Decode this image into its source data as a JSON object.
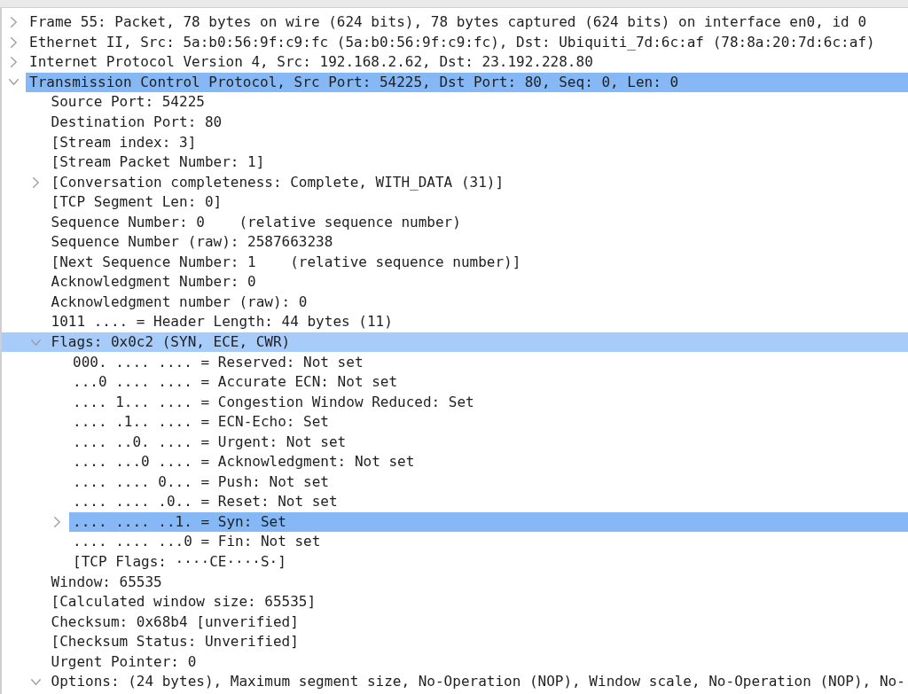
{
  "tree": [
    {
      "kind": "group",
      "label": "Frame 55: Packet, 78 bytes on wire (624 bits), 78 bytes captured (624 bits) on interface en0, id 0",
      "expanded": false,
      "selected": false,
      "highlighted": false
    },
    {
      "kind": "group",
      "label": "Ethernet II, Src: 5a:b0:56:9f:c9:fc (5a:b0:56:9f:c9:fc), Dst: Ubiquiti_7d:6c:af (78:8a:20:7d:6c:af)",
      "expanded": false,
      "selected": false,
      "highlighted": false
    },
    {
      "kind": "group",
      "label": "Internet Protocol Version 4, Src: 192.168.2.62, Dst: 23.192.228.80",
      "expanded": false,
      "selected": false,
      "highlighted": false
    },
    {
      "kind": "group",
      "label": "Transmission Control Protocol, Src Port: 54225, Dst Port: 80, Seq: 0, Len: 0",
      "expanded": true,
      "selected": true,
      "highlighted": false,
      "children": [
        {
          "kind": "field",
          "label": "Source Port: 54225",
          "selected": false,
          "highlighted": false
        },
        {
          "kind": "field",
          "label": "Destination Port: 80",
          "selected": false,
          "highlighted": false
        },
        {
          "kind": "field",
          "label": "[Stream index: 3]",
          "selected": false,
          "highlighted": false
        },
        {
          "kind": "field",
          "label": "[Stream Packet Number: 1]",
          "selected": false,
          "highlighted": false
        },
        {
          "kind": "group",
          "label": "[Conversation completeness: Complete, WITH_DATA (31)]",
          "expanded": false,
          "selected": false,
          "highlighted": false
        },
        {
          "kind": "field",
          "label": "[TCP Segment Len: 0]",
          "selected": false,
          "highlighted": false
        },
        {
          "kind": "field",
          "label": "Sequence Number: 0    (relative sequence number)",
          "selected": false,
          "highlighted": false
        },
        {
          "kind": "field",
          "label": "Sequence Number (raw): 2587663238",
          "selected": false,
          "highlighted": false
        },
        {
          "kind": "field",
          "label": "[Next Sequence Number: 1    (relative sequence number)]",
          "selected": false,
          "highlighted": false
        },
        {
          "kind": "field",
          "label": "Acknowledgment Number: 0",
          "selected": false,
          "highlighted": false
        },
        {
          "kind": "field",
          "label": "Acknowledgment number (raw): 0",
          "selected": false,
          "highlighted": false
        },
        {
          "kind": "field",
          "label": "1011 .... = Header Length: 44 bytes (11)",
          "selected": false,
          "highlighted": false
        },
        {
          "kind": "group",
          "label": "Flags: 0x0c2 (SYN, ECE, CWR)",
          "expanded": true,
          "selected": false,
          "highlighted": true,
          "children": [
            {
              "kind": "field",
              "label": "000. .... .... = Reserved: Not set",
              "selected": false,
              "highlighted": false
            },
            {
              "kind": "field",
              "label": "...0 .... .... = Accurate ECN: Not set",
              "selected": false,
              "highlighted": false
            },
            {
              "kind": "field",
              "label": ".... 1... .... = Congestion Window Reduced: Set",
              "selected": false,
              "highlighted": false
            },
            {
              "kind": "field",
              "label": ".... .1.. .... = ECN-Echo: Set",
              "selected": false,
              "highlighted": false
            },
            {
              "kind": "field",
              "label": ".... ..0. .... = Urgent: Not set",
              "selected": false,
              "highlighted": false
            },
            {
              "kind": "field",
              "label": ".... ...0 .... = Acknowledgment: Not set",
              "selected": false,
              "highlighted": false
            },
            {
              "kind": "field",
              "label": ".... .... 0... = Push: Not set",
              "selected": false,
              "highlighted": false
            },
            {
              "kind": "field",
              "label": ".... .... .0.. = Reset: Not set",
              "selected": false,
              "highlighted": false
            },
            {
              "kind": "group",
              "label": ".... .... ..1. = Syn: Set",
              "expanded": false,
              "selected": true,
              "highlighted": false
            },
            {
              "kind": "field",
              "label": ".... .... ...0 = Fin: Not set",
              "selected": false,
              "highlighted": false
            },
            {
              "kind": "field",
              "label": "[TCP Flags: ····CE····S·]",
              "selected": false,
              "highlighted": false
            }
          ]
        },
        {
          "kind": "field",
          "label": "Window: 65535",
          "selected": false,
          "highlighted": false
        },
        {
          "kind": "field",
          "label": "[Calculated window size: 65535]",
          "selected": false,
          "highlighted": false
        },
        {
          "kind": "field",
          "label": "Checksum: 0x68b4 [unverified]",
          "selected": false,
          "highlighted": false
        },
        {
          "kind": "field",
          "label": "[Checksum Status: Unverified]",
          "selected": false,
          "highlighted": false
        },
        {
          "kind": "field",
          "label": "Urgent Pointer: 0",
          "selected": false,
          "highlighted": false
        },
        {
          "kind": "group",
          "label": "Options: (24 bytes), Maximum segment size, No-Operation (NOP), Window scale, No-Operation (NOP), No-",
          "expanded": true,
          "selected": false,
          "highlighted": false
        }
      ]
    }
  ]
}
